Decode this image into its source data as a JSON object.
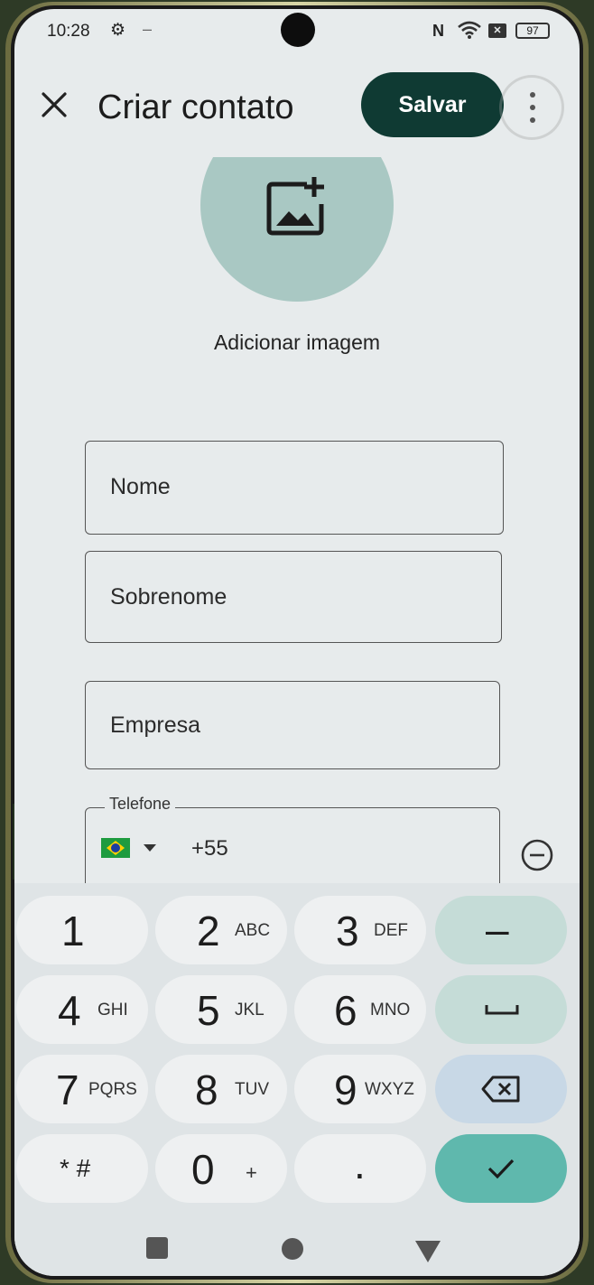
{
  "status_bar": {
    "time": "10:28",
    "settings_icon": "gear-icon",
    "indicator": "–",
    "nfc": "N",
    "battery": "97"
  },
  "app_bar": {
    "title": "Criar contato",
    "save_label": "Salvar"
  },
  "avatar": {
    "add_image_label": "Adicionar imagem",
    "accent": "#a9c8c3"
  },
  "form": {
    "first_name_placeholder": "Nome",
    "last_name_placeholder": "Sobrenome",
    "company_placeholder": "Empresa",
    "phone_label": "Telefone",
    "phone_value": "+55",
    "country_icon": "brazil-flag-icon"
  },
  "keypad": {
    "keys": [
      {
        "num": "1",
        "letters": ""
      },
      {
        "num": "2",
        "letters": "ABC"
      },
      {
        "num": "3",
        "letters": "DEF"
      },
      {
        "num": "–",
        "letters": ""
      },
      {
        "num": "4",
        "letters": "GHI"
      },
      {
        "num": "5",
        "letters": "JKL"
      },
      {
        "num": "6",
        "letters": "MNO"
      },
      {
        "num": "7",
        "letters": "PQRS"
      },
      {
        "num": "8",
        "letters": "TUV"
      },
      {
        "num": "9",
        "letters": "WXYZ"
      },
      {
        "num": "* #",
        "letters": ""
      },
      {
        "num": "0",
        "letters": "+"
      },
      {
        "num": ".",
        "letters": ""
      }
    ]
  },
  "colors": {
    "primary_button": "#0f3a33",
    "confirm_key": "#5fb8ad",
    "action_key": "#c5dcd7"
  }
}
